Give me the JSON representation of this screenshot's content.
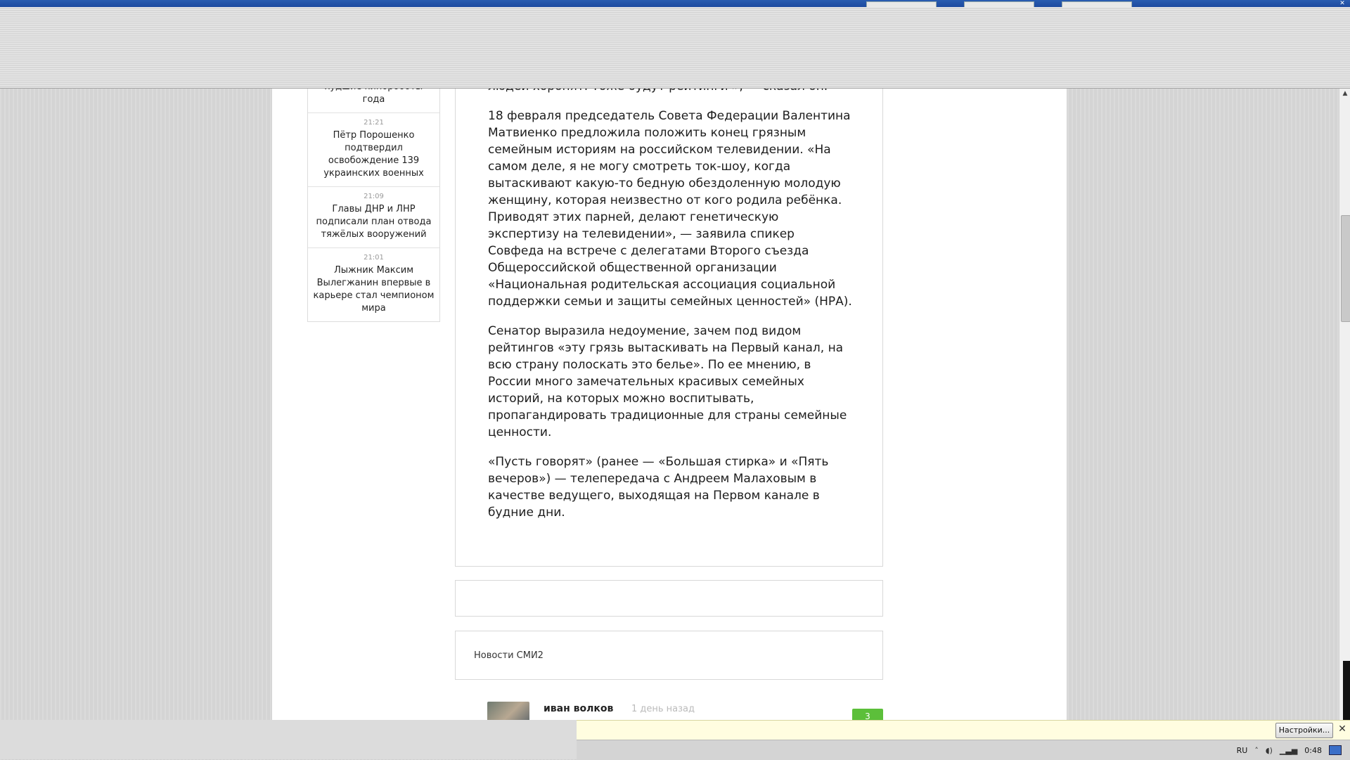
{
  "browser": {
    "window_close": "✕"
  },
  "sidebar": {
    "news": [
      {
        "time": "",
        "title": "худшие кинороботы года"
      },
      {
        "time": "21:21",
        "title": "Пётр Порошенко подтвердил освобождение 139 украинских военных"
      },
      {
        "time": "21:09",
        "title": "Главы ДНР и ЛНР подписали план отвода тяжёлых вооружений"
      },
      {
        "time": "21:01",
        "title": "Лыжник Максим Вылегжанин впервые в карьере стал чемпионом мира"
      }
    ]
  },
  "article": {
    "paragraphs": [
      "пусть поставят камеру на кладбище и снимают, как людей хоронят. Тоже будут рейтинги », — сказал он.",
      "18 февраля председатель Совета Федерации Валентина Матвиенко предложила положить конец грязным семейным историям на российском телевидении. «На самом деле, я не могу смотреть ток-шоу, когда вытаскивают какую-то бедную обездоленную молодую женщину, которая неизвестно от кого родила ребёнка. Приводят этих парней, делают генетическую экспертизу на телевидении», — заявила спикер Совфеда на встрече с делегатами Второго съезда Общероссийской общественной организации «Национальная родительская ассоциация социальной поддержки семьи и защиты семейных ценностей» (НРА).",
      "Сенатор выразила недоумение, зачем под видом рейтингов «эту грязь вытаскивать на Первый канал, на всю страну полоскать это белье». По ее мнению, в России много замечательных красивых семейных историй, на которых можно воспитывать, пропагандировать традиционные для страны семейные ценности.",
      "«Пусть говорят» (ранее — «Большая стирка» и «Пять вечеров») — телепередача с Андреем Малаховым в качестве ведущего, выходящая на Первом канале в будние дни."
    ]
  },
  "smi": {
    "label": "Новости СМИ2"
  },
  "comment": {
    "author": "иван волков",
    "time": "1 день назад",
    "votes": "3"
  },
  "notification": {
    "settings_label": "Настройки...",
    "close": "✕"
  },
  "tray": {
    "lang": "RU",
    "clock": "0:48"
  },
  "scroll": {
    "up": "▲"
  }
}
